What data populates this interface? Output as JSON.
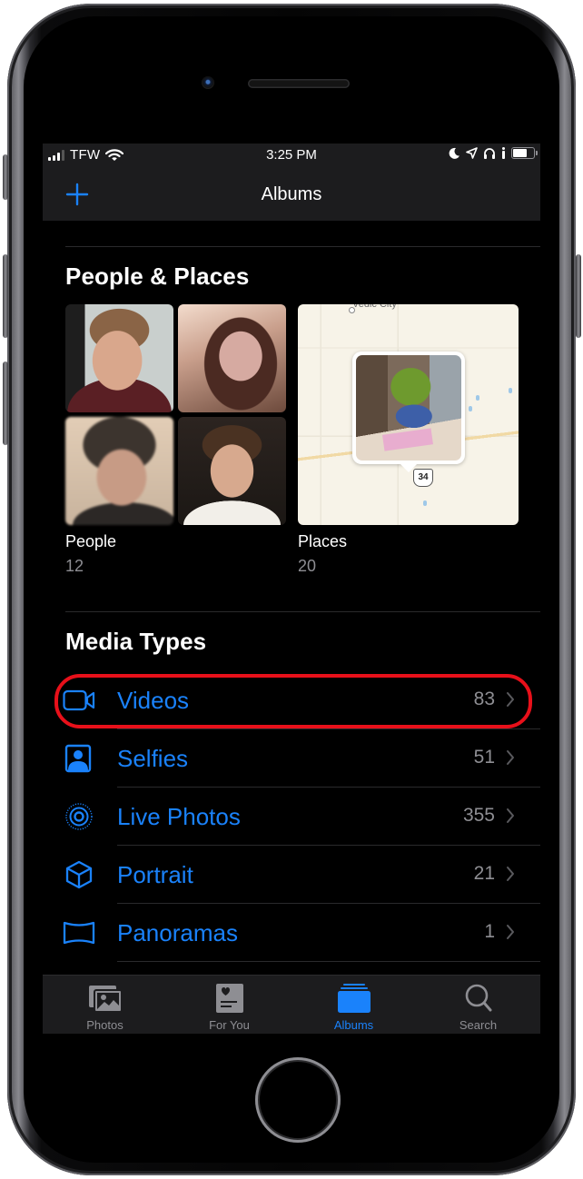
{
  "status_bar": {
    "carrier": "TFW",
    "time": "3:25 PM",
    "icons": [
      "signal-icon",
      "wifi-icon",
      "moon-icon",
      "location-arrow-icon",
      "headphones-icon",
      "battery-icon"
    ]
  },
  "nav": {
    "title": "Albums",
    "add_icon": "plus-icon"
  },
  "people_places": {
    "title": "People & Places",
    "people": {
      "label": "People",
      "count": "12"
    },
    "places": {
      "label": "Places",
      "count": "20",
      "map_city": "Vedic City",
      "route_shield": "34"
    }
  },
  "media_types": {
    "title": "Media Types",
    "items": [
      {
        "label": "Videos",
        "count": "83",
        "icon": "video-camera-icon",
        "highlighted": true
      },
      {
        "label": "Selfies",
        "count": "51",
        "icon": "selfie-portrait-icon",
        "highlighted": false
      },
      {
        "label": "Live Photos",
        "count": "355",
        "icon": "live-photo-icon",
        "highlighted": false
      },
      {
        "label": "Portrait",
        "count": "21",
        "icon": "cube-icon",
        "highlighted": false
      },
      {
        "label": "Panoramas",
        "count": "1",
        "icon": "panorama-icon",
        "highlighted": false
      }
    ]
  },
  "tab_bar": {
    "tabs": [
      {
        "label": "Photos",
        "icon": "photos-icon",
        "active": false
      },
      {
        "label": "For You",
        "icon": "for-you-icon",
        "active": false
      },
      {
        "label": "Albums",
        "icon": "albums-icon",
        "active": true
      },
      {
        "label": "Search",
        "icon": "search-icon",
        "active": false
      }
    ]
  },
  "colors": {
    "accent": "#1a82fb",
    "highlight_ring": "#e8101a",
    "secondary_text": "#8e8e93",
    "bar_background": "#1c1c1e",
    "background": "#000000"
  }
}
